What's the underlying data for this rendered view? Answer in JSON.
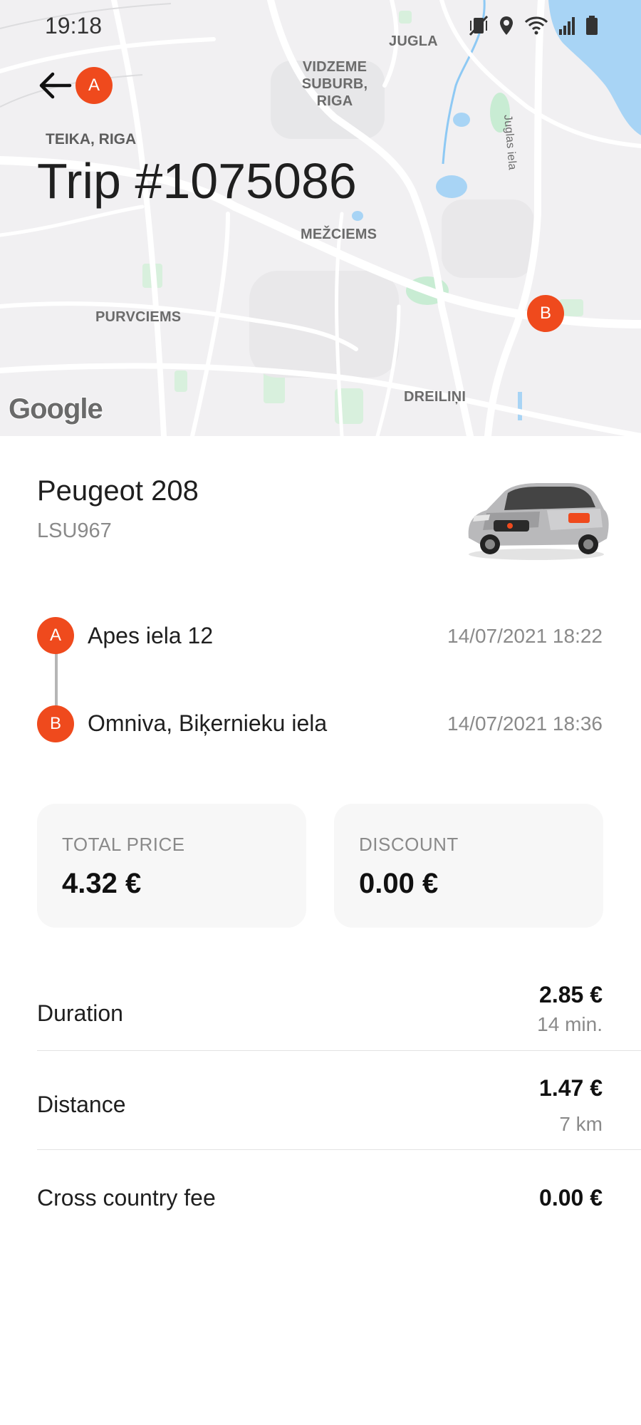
{
  "status_bar": {
    "time": "19:18",
    "icons": [
      "mute-vibrate-icon",
      "location-icon",
      "wifi-icon",
      "signal-icon",
      "battery-icon"
    ]
  },
  "map": {
    "labels": {
      "jugla": "JUGLA",
      "vidzeme_line1": "VIDZEME",
      "vidzeme_line2": "SUBURB, RIGA",
      "juglas_iela": "Juglas iela",
      "mezciems": "MEŽCIEMS",
      "purvciems": "PURVCIEMS",
      "dreilini": "DREILIŅI"
    },
    "pin_a": "A",
    "pin_b": "B",
    "google": "Google",
    "colors": {
      "land": "#f1f0f2",
      "road": "#ffffff",
      "park": "#c8ecd3",
      "water": "#8ec9f4",
      "pin": "#ef4a1d"
    }
  },
  "header": {
    "back_icon": "arrow-left-icon",
    "subtitle": "TEIKA, RIGA",
    "title": "Trip #1075086"
  },
  "car": {
    "name": "Peugeot 208",
    "plate": "LSU967",
    "image_icon": "car-image"
  },
  "route": {
    "start": {
      "marker": "A",
      "address": "Apes iela 12",
      "time": "14/07/2021 18:22"
    },
    "end": {
      "marker": "B",
      "address": "Omniva, Biķernieku iela",
      "time": "14/07/2021 18:36"
    }
  },
  "summary": {
    "total": {
      "label": "TOTAL PRICE",
      "value": "4.32 €"
    },
    "discount": {
      "label": "DISCOUNT",
      "value": "0.00 €"
    }
  },
  "breakdown": [
    {
      "label": "Duration",
      "price": "2.85 €",
      "detail": "14 min."
    },
    {
      "label": "Distance",
      "price": "1.47 €",
      "detail": "7 km"
    },
    {
      "label": "Cross country fee",
      "price": "0.00 €",
      "detail": ""
    }
  ]
}
